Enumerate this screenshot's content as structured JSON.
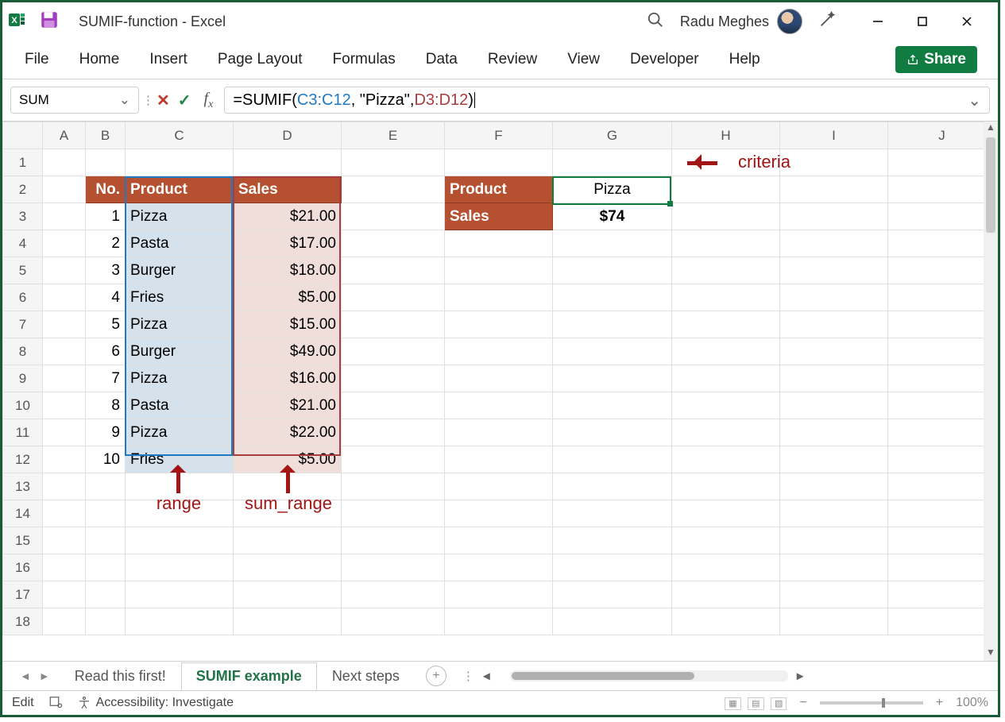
{
  "title": {
    "doc": "SUMIF-function",
    "sep": "  -  ",
    "app": "Excel"
  },
  "user": "Radu Meghes",
  "ribbon": [
    "File",
    "Home",
    "Insert",
    "Page Layout",
    "Formulas",
    "Data",
    "Review",
    "View",
    "Developer",
    "Help"
  ],
  "share": "Share",
  "namebox": "SUM",
  "formula": {
    "prefix": "=SUMIF(",
    "ref1": "C3:C12",
    "mid1": ", \"Pizza\", ",
    "ref2": "D3:D12",
    "suffix": ")"
  },
  "columns": [
    "A",
    "B",
    "C",
    "D",
    "E",
    "F",
    "G",
    "H",
    "I",
    "J"
  ],
  "row_numbers": [
    1,
    2,
    3,
    4,
    5,
    6,
    7,
    8,
    9,
    10,
    11,
    12,
    13,
    14,
    15,
    16,
    17,
    18
  ],
  "table_headers": {
    "no": "No.",
    "product": "Product",
    "sales": "Sales"
  },
  "rows": [
    {
      "no": "1",
      "product": "Pizza",
      "sales": "$21.00"
    },
    {
      "no": "2",
      "product": "Pasta",
      "sales": "$17.00"
    },
    {
      "no": "3",
      "product": "Burger",
      "sales": "$18.00"
    },
    {
      "no": "4",
      "product": "Fries",
      "sales": "$5.00"
    },
    {
      "no": "5",
      "product": "Pizza",
      "sales": "$15.00"
    },
    {
      "no": "6",
      "product": "Burger",
      "sales": "$49.00"
    },
    {
      "no": "7",
      "product": "Pizza",
      "sales": "$16.00"
    },
    {
      "no": "8",
      "product": "Pasta",
      "sales": "$21.00"
    },
    {
      "no": "9",
      "product": "Pizza",
      "sales": "$22.00"
    },
    {
      "no": "10",
      "product": "Fries",
      "sales": "$5.00"
    }
  ],
  "summary": {
    "product_label": "Product",
    "product_value": "Pizza",
    "sales_label": "Sales",
    "sales_value": "$74"
  },
  "annotations": {
    "range": "range",
    "sum_range": "sum_range",
    "criteria": "criteria"
  },
  "sheets": [
    "Read this first!",
    "SUMIF example",
    "Next steps"
  ],
  "active_sheet": 1,
  "status": {
    "mode": "Edit",
    "accessibility": "Accessibility: Investigate",
    "zoom": "100%"
  }
}
